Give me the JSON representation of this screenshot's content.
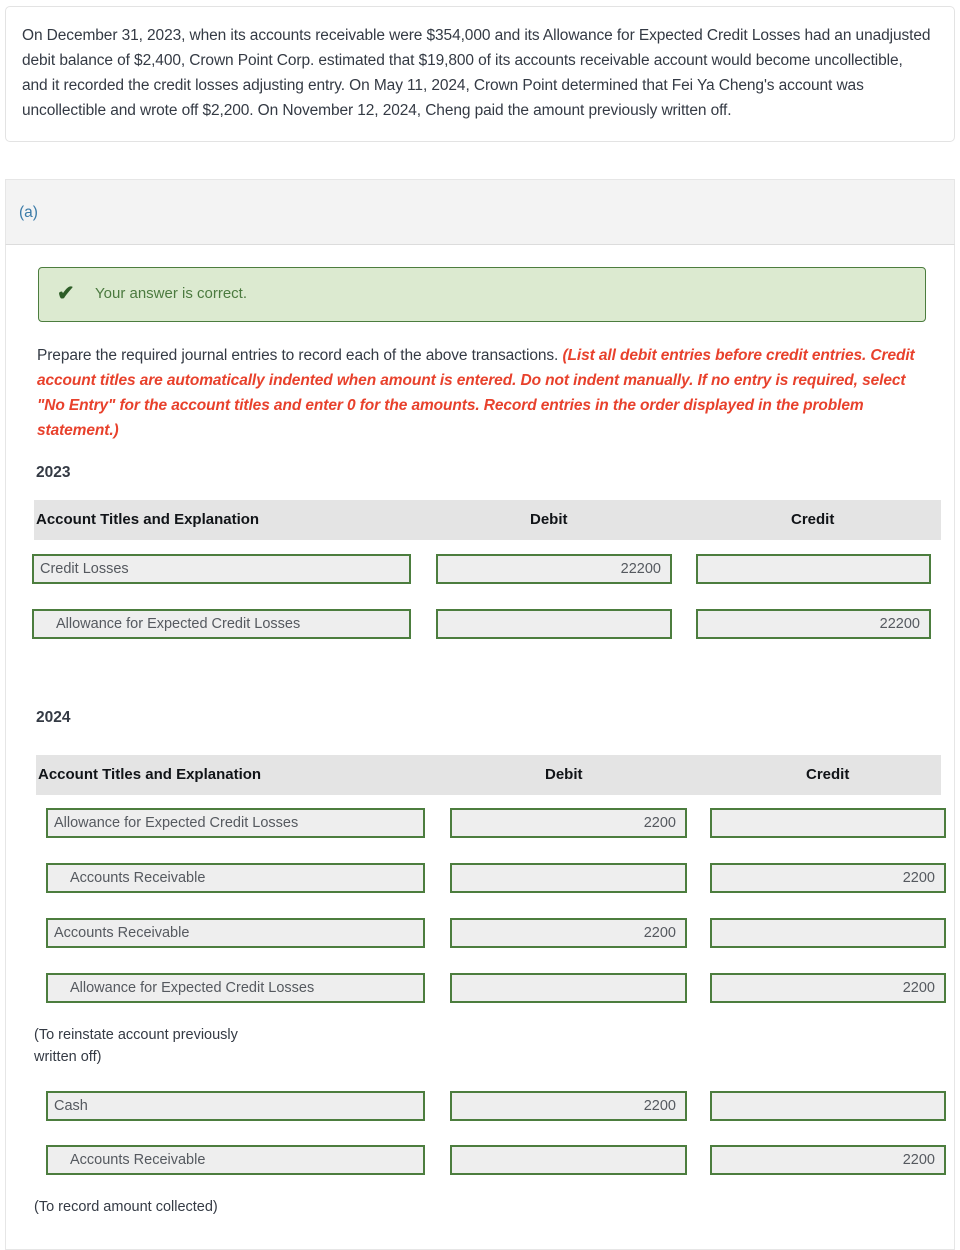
{
  "problem": {
    "text": "On December 31, 2023, when its accounts receivable were $354,000 and its Allowance for Expected Credit Losses had an unadjusted debit balance of $2,400, Crown Point Corp. estimated that $19,800 of its accounts receivable account would become uncollectible, and it recorded the credit losses adjusting entry. On May 11, 2024, Crown Point determined that Fei Ya Cheng's account was uncollectible and wrote off $2,200. On November 12, 2024, Cheng paid the amount previously written off."
  },
  "part": {
    "label": "(a)"
  },
  "banner": {
    "icon": "check-icon",
    "text": "Your answer is correct.",
    "background_color": "#dcead0",
    "border_color": "#4c7d3e",
    "text_color": "#4b7a3f"
  },
  "instructions": {
    "lead": "Prepare the required journal entries to record each of the above transactions. ",
    "emphasis": "(List all debit entries before credit entries. Credit account titles are automatically indented when amount is entered. Do not indent manually. If no entry is required, select \"No Entry\" for the account titles and enter 0 for the amounts. Record entries in the order displayed in the problem statement.)",
    "emphasis_color": "#e8412c"
  },
  "columns": {
    "title": "Account Titles and Explanation",
    "debit": "Debit",
    "credit": "Credit"
  },
  "sections": [
    {
      "year": "2023",
      "rows": [
        {
          "title": "Credit Losses",
          "indent": false,
          "debit": "22200",
          "credit": ""
        },
        {
          "title": "Allowance for Expected Credit Losses",
          "indent": true,
          "debit": "",
          "credit": "22200"
        }
      ]
    },
    {
      "year": "2024",
      "rows": [
        {
          "title": "Allowance for Expected Credit Losses",
          "indent": false,
          "debit": "2200",
          "credit": ""
        },
        {
          "title": "Accounts Receivable",
          "indent": true,
          "debit": "",
          "credit": "2200"
        },
        {
          "title": "Accounts Receivable",
          "indent": false,
          "debit": "2200",
          "credit": ""
        },
        {
          "title": "Allowance for Expected Credit Losses",
          "indent": true,
          "debit": "",
          "credit": "2200"
        },
        {
          "title": "Cash",
          "indent": false,
          "debit": "2200",
          "credit": ""
        },
        {
          "title": "Accounts Receivable",
          "indent": true,
          "debit": "",
          "credit": "2200"
        }
      ],
      "notes": [
        "(To reinstate account previously\nwritten off)",
        "(To record amount collected)"
      ]
    }
  ],
  "theme": {
    "input_border": "#4c7d3e",
    "input_fill": "#eeeeee",
    "header_fill": "#e4e4e4",
    "part_header_fill": "#f3f3f3",
    "part_label_color": "#3b7ba8",
    "body_text": "#343a44"
  }
}
